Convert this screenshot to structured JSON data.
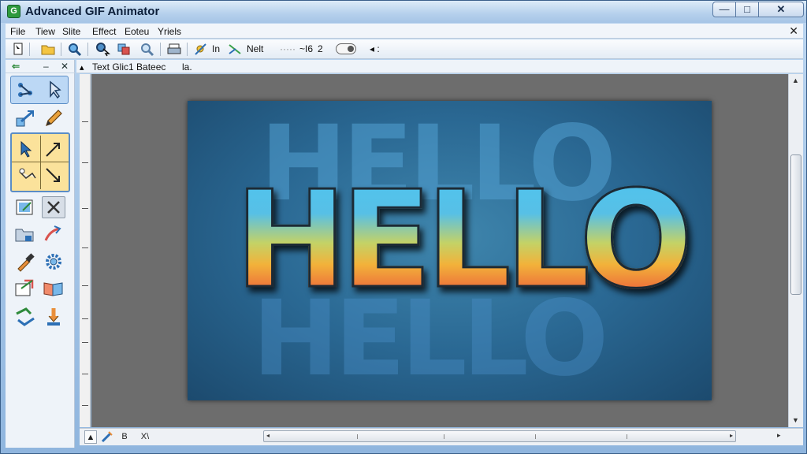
{
  "window": {
    "title": "Advanced GIF Animator",
    "app_icon": "gif-animator-app-icon",
    "controls": {
      "minimize": "—",
      "maximize": "□",
      "close": "✕"
    }
  },
  "menubar": {
    "items": [
      "File",
      "Tiew",
      "Slite",
      "Effect",
      "Eoteu",
      "Yriels"
    ],
    "close_symbol": "✕"
  },
  "toolbar": {
    "text_items": [
      "In",
      "Nelt",
      "·····",
      "~I6",
      "2"
    ],
    "trailing": "◂ :"
  },
  "palette": {
    "top_controls": [
      "⇐",
      "–",
      "✕"
    ],
    "tools": [
      "node-select-icon",
      "direct-select-icon",
      "arrow-move-icon",
      "pencil-icon",
      "pointer-icon",
      "transform-arrow-icon",
      "crop-corner-icon",
      "resize-arrow-icon",
      "frame-edit-icon",
      "close-x-icon",
      "folder-icon",
      "curve-arrow-icon",
      "eyedropper-icon",
      "gear-icon",
      "frame-add-icon",
      "open-book-icon",
      "swap-arrows-icon",
      "import-down-icon"
    ]
  },
  "document": {
    "tab_label": "Text Glic1 Bateec",
    "tab_suffix": "la.",
    "canvas_text": "HELLO"
  },
  "statusbar": {
    "buttons": [
      "▲",
      "",
      "B",
      "X\\"
    ],
    "scroll_end": "▸"
  },
  "colors": {
    "accent_blue": "#5b8dc6",
    "tool_group_gold": "#fbe29b",
    "canvas_bg": "#6d6d6d",
    "image_bg": "#2a6893"
  }
}
